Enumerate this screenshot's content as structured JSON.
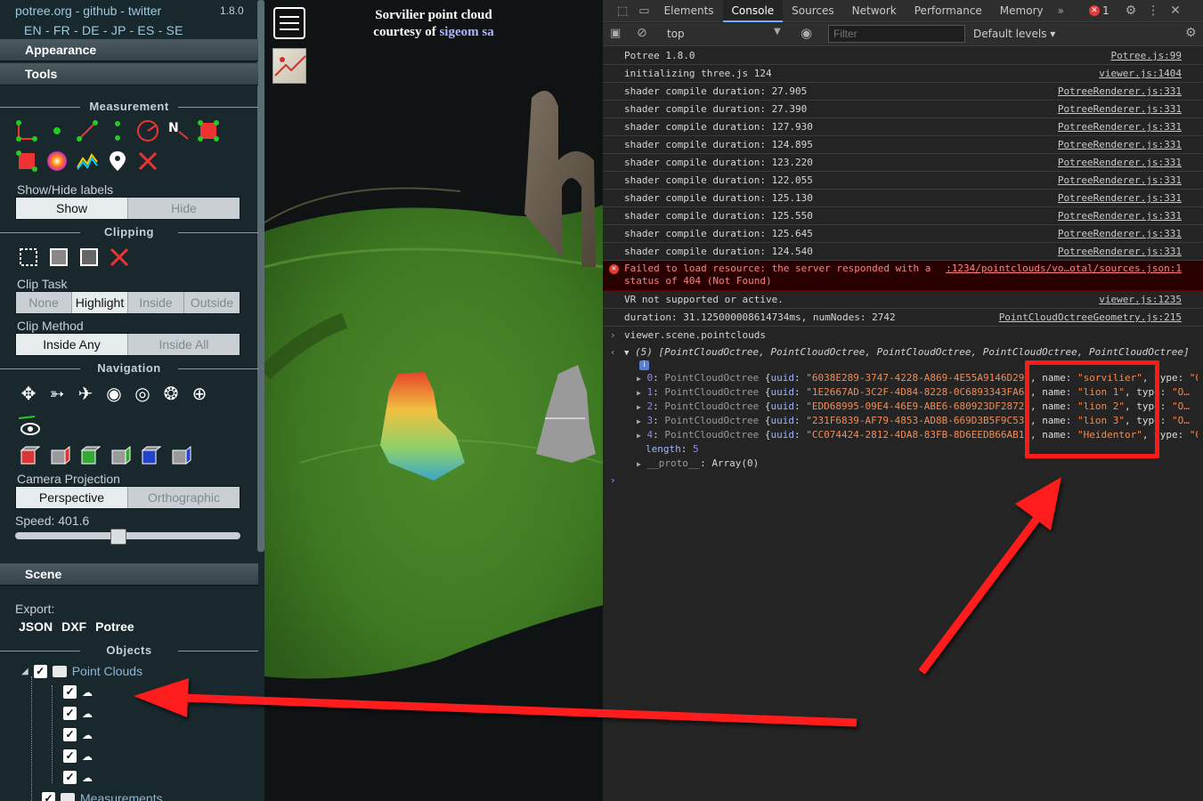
{
  "sidebar": {
    "header_links": "potree.org - github - twitter",
    "version": "1.8.0",
    "languages": "EN - FR - DE - JP - ES - SE",
    "appearance": "Appearance",
    "tools": "Tools",
    "measurement_title": "Measurement",
    "show_hide_labels": "Show/Hide labels",
    "label_buttons": [
      "Show",
      "Hide"
    ],
    "clipping_title": "Clipping",
    "clip_task_label": "Clip Task",
    "clip_task_options": [
      "None",
      "Highlight",
      "Inside",
      "Outside"
    ],
    "clip_method_label": "Clip Method",
    "clip_method_options": [
      "Inside Any",
      "Inside All"
    ],
    "navigation_title": "Navigation",
    "camera_projection_label": "Camera Projection",
    "projection_options": [
      "Perspective",
      "Orthographic"
    ],
    "speed": "Speed: 401.6",
    "speed_level": 0.46,
    "scene": "Scene",
    "export_label": "Export:",
    "export_options": [
      "JSON",
      "DXF",
      "Potree"
    ],
    "objects_title": "Objects",
    "tree_point_clouds": "Point Clouds",
    "tree_measurements": "Measurements"
  },
  "viewer": {
    "caption_line1": "Sorvilier point cloud",
    "caption_line2_prefix": "courtesy of",
    "caption_link": "sigeom sa"
  },
  "devtools": {
    "tabs": [
      "Elements",
      "Console",
      "Sources",
      "Network",
      "Performance",
      "Memory"
    ],
    "active_tab": "Console",
    "error_count": "1",
    "context": "top",
    "filter_placeholder": "Filter",
    "levels": "Default levels",
    "logs": [
      {
        "msg": "Potree 1.8.0",
        "src": "Potree.js:99"
      },
      {
        "msg": "initializing three.js 124",
        "src": "viewer.js:1404"
      },
      {
        "msg": "shader compile duration: 27.905",
        "src": "PotreeRenderer.js:331"
      },
      {
        "msg": "shader compile duration: 27.390",
        "src": "PotreeRenderer.js:331"
      },
      {
        "msg": "shader compile duration: 127.930",
        "src": "PotreeRenderer.js:331"
      },
      {
        "msg": "shader compile duration: 124.895",
        "src": "PotreeRenderer.js:331"
      },
      {
        "msg": "shader compile duration: 123.220",
        "src": "PotreeRenderer.js:331"
      },
      {
        "msg": "shader compile duration: 122.055",
        "src": "PotreeRenderer.js:331"
      },
      {
        "msg": "shader compile duration: 125.130",
        "src": "PotreeRenderer.js:331"
      },
      {
        "msg": "shader compile duration: 125.550",
        "src": "PotreeRenderer.js:331"
      },
      {
        "msg": "shader compile duration: 125.645",
        "src": "PotreeRenderer.js:331"
      },
      {
        "msg": "shader compile duration: 124.540",
        "src": "PotreeRenderer.js:331"
      }
    ],
    "error_line1": "Failed to load resource: the server responded with a",
    "error_line2": "status of 404 (Not Found)",
    "error_src": ":1234/pointclouds/vo…otal/sources.json:1",
    "vr_msg": "VR not supported or active.",
    "vr_src": "viewer.js:1235",
    "duration_msg": "duration: 31.125000008614734ms, numNodes: 2742",
    "duration_src": "PointCloudOctreeGeometry.js:215",
    "input_cmd": "viewer.scene.pointclouds",
    "result_summary": "(5) [PointCloudOctree, PointCloudOctree, PointCloudOctree, PointCloudOctree, PointCloudOctree]",
    "entries": [
      {
        "idx": "0",
        "uuid": "\"6038E289-3747-4228-A869-4E55A9146D29\"",
        "name": "\"sorvilier\""
      },
      {
        "idx": "1",
        "uuid": "\"1E2667AD-3C2F-4D84-8228-0C6893343FA6\"",
        "name": "\"lion 1\""
      },
      {
        "idx": "2",
        "uuid": "\"EDD68995-09E4-46E9-ABE6-680923DF2872\"",
        "name": "\"lion 2\""
      },
      {
        "idx": "3",
        "uuid": "\"231F6839-AF79-4853-AD8B-669D3B5F9C53\"",
        "name": "\"lion 3\""
      },
      {
        "idx": "4",
        "uuid": "\"CC074424-2812-4DA8-83FB-8D6EEDB66AB1\"",
        "name": "\"Heidentor\""
      }
    ],
    "entry_class": "PointCloudOctree",
    "length_label": "length",
    "length_value": "5",
    "proto_label": "__proto__",
    "proto_value": "Array(0)"
  },
  "colors": {
    "annotation_red": "#ff1a1a",
    "link_blue": "#9ccbe0",
    "accent": "#7cacf8"
  }
}
